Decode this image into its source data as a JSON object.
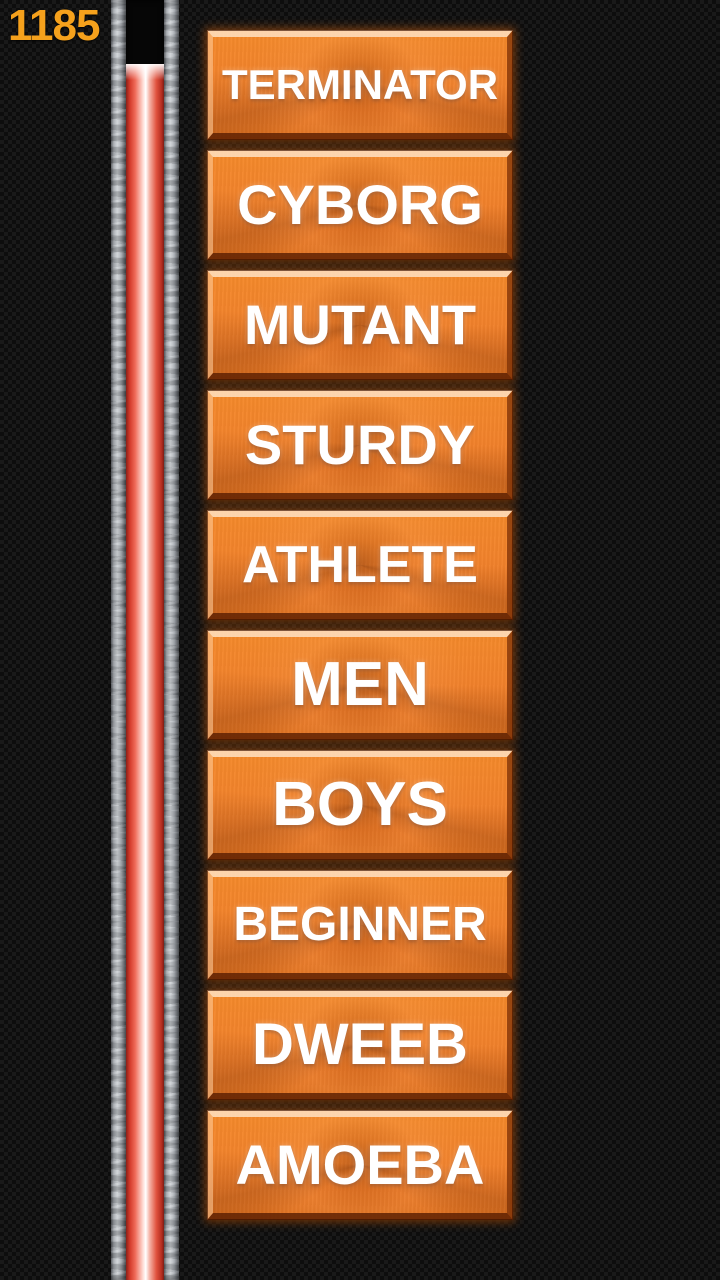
{
  "hud": {
    "score": "1185",
    "score_color": "#f5a11c"
  },
  "power_tube": {
    "name": "power-meter",
    "fill_color_core": "#ffffff",
    "fill_color_edge": "#d33a2a",
    "frame_color": "#b9bec4",
    "fill_percent": 95
  },
  "background": {
    "base_color": "#0d0d0d",
    "pattern_color": "#191919"
  },
  "menu": {
    "accent_color": "#f2822b",
    "buttons": [
      {
        "label": "TERMINATOR",
        "name": "difficulty-terminator"
      },
      {
        "label": "CYBORG",
        "name": "difficulty-cyborg"
      },
      {
        "label": "MUTANT",
        "name": "difficulty-mutant"
      },
      {
        "label": "STURDY",
        "name": "difficulty-sturdy"
      },
      {
        "label": "ATHLETE",
        "name": "difficulty-athlete"
      },
      {
        "label": "MEN",
        "name": "difficulty-men"
      },
      {
        "label": "BOYS",
        "name": "difficulty-boys"
      },
      {
        "label": "BEGINNER",
        "name": "difficulty-beginner"
      },
      {
        "label": "DWEEB",
        "name": "difficulty-dweeb"
      },
      {
        "label": "AMOEBA",
        "name": "difficulty-amoeba"
      }
    ]
  }
}
